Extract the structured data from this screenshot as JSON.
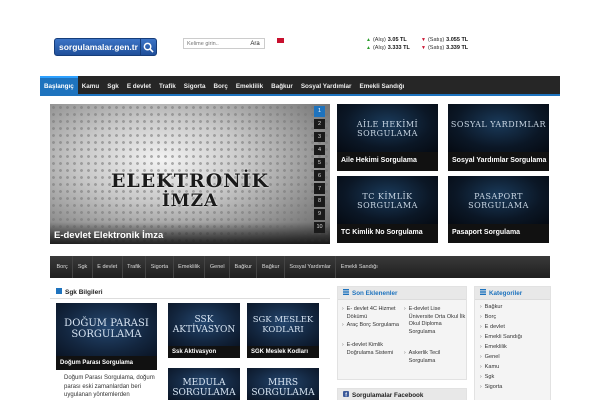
{
  "header": {
    "logo_text": "sorgulamalar.gen.tr",
    "search_placeholder": "Kelime girin..",
    "search_button": "Ara",
    "fx": [
      {
        "label": "(Alış)",
        "value": "3.05 TL"
      },
      {
        "label": "(Satış)",
        "value": "3.055 TL"
      },
      {
        "label": "(Alış)",
        "value": "3.333 TL"
      },
      {
        "label": "(Satış)",
        "value": "3.339 TL"
      }
    ]
  },
  "nav": {
    "items": [
      "Başlangıç",
      "Kamu",
      "Sgk",
      "E devlet",
      "Trafik",
      "Sigorta",
      "Borç",
      "Emeklilik",
      "Bağkur",
      "Sosyal Yardımlar",
      "Emekli Sandığı"
    ]
  },
  "slider": {
    "image_text_line1": "ELEKTRONİK",
    "image_text_line2": "İMZA",
    "caption": "E-devlet Elektronik İmza",
    "pages": [
      "1",
      "2",
      "3",
      "4",
      "5",
      "6",
      "7",
      "8",
      "9",
      "10"
    ]
  },
  "tiles": [
    {
      "image_text": "AİLE HEKİMİ SORGULAMA",
      "caption": "Aile Hekimi Sorgulama"
    },
    {
      "image_text": "SOSYAL YARDIMLAR",
      "caption": "Sosyal Yardımlar Sorgulama"
    },
    {
      "image_text": "TC KİMLİK SORGULAMA",
      "caption": "TC Kimlik No Sorgulama"
    },
    {
      "image_text": "PASAPORT SORGULAMA",
      "caption": "Pasaport Sorgulama"
    }
  ],
  "subnav": {
    "items": [
      "Borç",
      "Sgk",
      "E devlet",
      "Trafik",
      "Sigorta",
      "Emeklilik",
      "Genel",
      "Bağkur",
      "Bağkur",
      "Sosyal Yardımlar",
      "Emekli Sandığı"
    ]
  },
  "sgk_widget": {
    "title": "Sgk Bilgileri",
    "cards": [
      {
        "image_text": "DOĞUM PARASI SORGULAMA",
        "caption": "Doğum Parası Sorgulama",
        "excerpt": "Doğum Parası Sorgulama, doğum parası eski zamanlardan beri uygulanan yöntemlerden"
      },
      {
        "image_text": "SSK AKTİVASYON",
        "caption": "Ssk Aktivasyon"
      },
      {
        "image_text": "SGK MESLEK KODLARI",
        "caption": "SGK Meslek Kodları"
      },
      {
        "image_text": "MEDULA SORGULAMA",
        "caption": ""
      },
      {
        "image_text": "MHRS SORGULAMA",
        "caption": ""
      }
    ]
  },
  "recent": {
    "title": "Son Eklenenler",
    "items": [
      {
        "text": "E- devlet 4C Hizmet Dökümü"
      },
      {
        "text": "E-devlet Lise Üniversite Orta Okul İlk Okul Diploma Sorgulama"
      },
      {
        "text": "Araç Borç Sorgulama"
      },
      {
        "text": "E-devlet Kimlik Doğrulama Sistemi"
      },
      {
        "text": "Askerlik Tecil Sorgulama"
      }
    ]
  },
  "categories": {
    "title": "Kategoriler",
    "items": [
      "Bağkur",
      "Borç",
      "E devlet",
      "Emekli Sandığı",
      "Emeklilik",
      "Genel",
      "Kamu",
      "Sgk",
      "Sigorta"
    ]
  },
  "facebook": {
    "title": "Sorgulamalar Facebook"
  },
  "colors": {
    "accent": "#1e73be",
    "nav_bg": "#262626"
  }
}
